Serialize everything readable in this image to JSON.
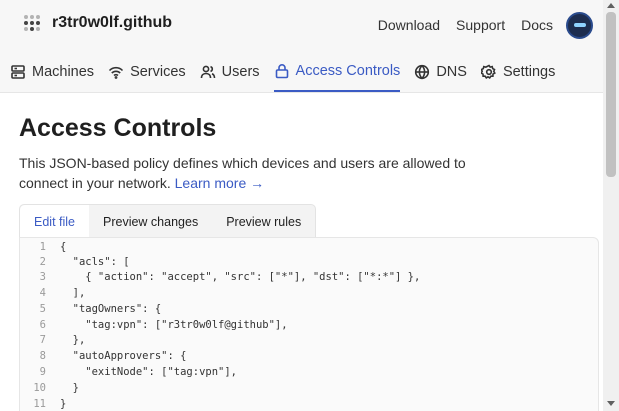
{
  "header": {
    "org_name": "r3tr0w0lf.github",
    "links": [
      "Download",
      "Support",
      "Docs"
    ],
    "logo_icon": "grid-dots-icon",
    "avatar_icon": "user-avatar"
  },
  "nav": {
    "items": [
      {
        "label": "Machines",
        "icon": "server-icon",
        "active": false
      },
      {
        "label": "Services",
        "icon": "wifi-icon",
        "active": false
      },
      {
        "label": "Users",
        "icon": "users-icon",
        "active": false
      },
      {
        "label": "Access Controls",
        "icon": "lock-icon",
        "active": true
      },
      {
        "label": "DNS",
        "icon": "globe-icon",
        "active": false
      },
      {
        "label": "Settings",
        "icon": "gear-icon",
        "active": false
      }
    ]
  },
  "page": {
    "title": "Access Controls",
    "description": "This JSON-based policy defines which devices and users are allowed to connect in your network.",
    "learn_more": "Learn more →"
  },
  "tabs": [
    {
      "label": "Edit file",
      "active": true
    },
    {
      "label": "Preview changes",
      "active": false
    },
    {
      "label": "Preview rules",
      "active": false
    }
  ],
  "editor": {
    "lines": [
      {
        "n": "1",
        "text": "{"
      },
      {
        "n": "2",
        "text": "  \"acls\": ["
      },
      {
        "n": "3",
        "text": "    { \"action\": \"accept\", \"src\": [\"*\"], \"dst\": [\"*:*\"] },"
      },
      {
        "n": "4",
        "text": "  ],"
      },
      {
        "n": "5",
        "text": "  \"tagOwners\": {"
      },
      {
        "n": "6",
        "text": "    \"tag:vpn\": [\"r3tr0w0lf@github\"],"
      },
      {
        "n": "7",
        "text": "  },"
      },
      {
        "n": "8",
        "text": "  \"autoApprovers\": {"
      },
      {
        "n": "9",
        "text": "    \"exitNode\": [\"tag:vpn\"],"
      },
      {
        "n": "10",
        "text": "  }"
      },
      {
        "n": "11",
        "text": "}"
      }
    ]
  },
  "colors": {
    "accent": "#3b5bc4",
    "key": "#a33d8f",
    "string": "#23806b"
  }
}
